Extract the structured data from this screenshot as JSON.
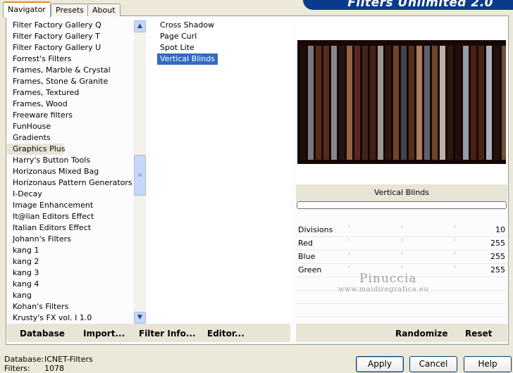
{
  "app": {
    "title": "Filters Unlimited 2.0"
  },
  "tabs": [
    {
      "label": "Navigator"
    },
    {
      "label": "Presets"
    },
    {
      "label": "About"
    }
  ],
  "categories": [
    "Filter Factory Gallery Q",
    "Filter Factory Gallery T",
    "Filter Factory Gallery U",
    "Forrest's Filters",
    "Frames, Marble & Crystal",
    "Frames, Stone & Granite",
    "Frames, Textured",
    "Frames, Wood",
    "Freeware filters",
    "FunHouse",
    "Gradients",
    "Graphics Plus",
    "Harry's Button Tools",
    "Horizonaus Mixed Bag",
    "Horizonaus Pattern Generators",
    "I-Decay",
    "Image Enhancement",
    "It@lian Editors Effect",
    "Italian Editors Effect",
    "Johann's Filters",
    "kang 1",
    "kang 2",
    "kang 3",
    "kang 4",
    "kang",
    "Kohan's Filters",
    "Krusty's FX vol. I 1.0"
  ],
  "selected_category": "Graphics Plus",
  "filters": [
    "Cross Shadow",
    "Page Curl",
    "Spot Lite",
    "Vertical Blinds"
  ],
  "selected_filter": "Vertical Blinds",
  "preview": {
    "filter_name": "Vertical Blinds",
    "progress": 0
  },
  "params": [
    {
      "label": "Divisions",
      "value": "10"
    },
    {
      "label": "Red",
      "value": "255"
    },
    {
      "label": "Blue",
      "value": "255"
    },
    {
      "label": "Green",
      "value": "255"
    }
  ],
  "watermark": {
    "line1": "Pinuccia",
    "line2": "www.maidiregrafica.eu"
  },
  "links": {
    "database": "Database",
    "import": "Import...",
    "filter_info": "Filter Info...",
    "editor": "Editor...",
    "randomize": "Randomize",
    "reset": "Reset"
  },
  "status": {
    "database_label": "Database:",
    "database_value": "ICNET-Filters",
    "filters_label": "Filters:",
    "filters_value": "1078"
  },
  "buttons": {
    "apply": "Apply",
    "cancel": "Cancel",
    "help": "Help"
  },
  "colors": {
    "banner": "#0b3a8c",
    "selection": "#316ac5",
    "accent_tab": "#e68b2c"
  }
}
